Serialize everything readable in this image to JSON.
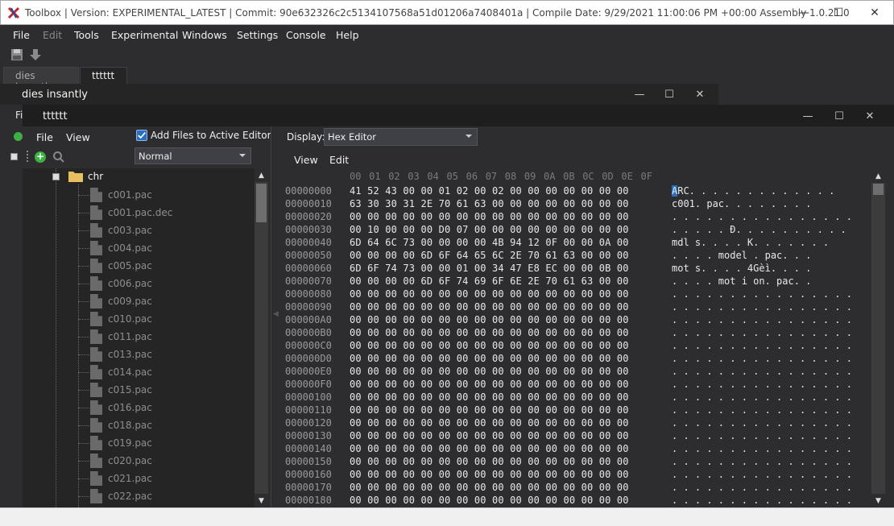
{
  "titlebar": {
    "title": "Toolbox | Version: EXPERIMENTAL_LATEST | Commit: 90e632326c2c5134107568a51d01206a7408401a | Compile Date: 9/29/2021 11:00:06 PM +00:00 Assembly 1.0.21.0",
    "minimize": "—",
    "maximize": "☐",
    "close": "✕"
  },
  "menubar": {
    "items": [
      "File",
      "Edit",
      "Tools",
      "Experimental",
      "Windows",
      "Settings",
      "Console",
      "Help"
    ]
  },
  "doc_tabs": [
    "dies insantly",
    "tttttt"
  ],
  "outer_window": {
    "title": "dies insantly",
    "side_label": "Fi"
  },
  "inner_window": {
    "title": "tttttt"
  },
  "left_panel": {
    "menu": [
      "File",
      "View"
    ],
    "add_files_label": "Add Files to Active Editor",
    "mode_value": "Normal",
    "tree": {
      "folder": "chr",
      "files": [
        "c001.pac",
        "c001.pac.dec",
        "c003.pac",
        "c004.pac",
        "c005.pac",
        "c006.pac",
        "c009.pac",
        "c010.pac",
        "c011.pac",
        "c013.pac",
        "c014.pac",
        "c015.pac",
        "c016.pac",
        "c018.pac",
        "c019.pac",
        "c020.pac",
        "c021.pac",
        "c022.pac"
      ]
    }
  },
  "right_panel": {
    "display_label": "Display:",
    "display_value": "Hex Editor",
    "menu": [
      "View",
      "Edit"
    ],
    "hex_header": [
      "00",
      "01",
      "02",
      "03",
      "04",
      "05",
      "06",
      "07",
      "08",
      "09",
      "0A",
      "0B",
      "0C",
      "0D",
      "0E",
      "0F"
    ],
    "rows": [
      {
        "addr": "00000000",
        "bytes": "41 52 43 00 00 01 02 00 02 00 00 00 00 00 00 00",
        "ascii_sel": "A",
        "ascii": "RC. . . . . . . . . . . . ."
      },
      {
        "addr": "00000010",
        "bytes": "63 30 30 31 2E 70 61 63 00 00 00 00 00 00 00 00",
        "ascii_sel": "",
        "ascii": "c001. pac. . . . . . . ."
      },
      {
        "addr": "00000020",
        "bytes": "00 00 00 00 00 00 00 00 00 00 00 00 00 00 00 00",
        "ascii_sel": "",
        "ascii": ". . . . . . . . . . . . . . . ."
      },
      {
        "addr": "00000030",
        "bytes": "00 10 00 00 00 D0 07 00 00 00 00 00 00 00 00 00",
        "ascii_sel": "",
        "ascii": ". . . . . Đ. . . . . . . . . ."
      },
      {
        "addr": "00000040",
        "bytes": "6D 64 6C 73 00 00 00 00 4B 94 12 0F 00 00 0A 00",
        "ascii_sel": "",
        "ascii": "mdl s. . . . K. . . . . . ."
      },
      {
        "addr": "00000050",
        "bytes": "00 00 00 00 6D 6F 64 65 6C 2E 70 61 63 00 00 00",
        "ascii_sel": "",
        "ascii": ". . . . model . pac. . ."
      },
      {
        "addr": "00000060",
        "bytes": "6D 6F 74 73 00 00 01 00 34 47 E8 EC 00 00 0B 00",
        "ascii_sel": "",
        "ascii": "mot s. . . . 4Gèì. . . ."
      },
      {
        "addr": "00000070",
        "bytes": "00 00 00 00 6D 6F 74 69 6F 6E 2E 70 61 63 00 00",
        "ascii_sel": "",
        "ascii": ". . . . mot i on. pac. ."
      },
      {
        "addr": "00000080",
        "bytes": "00 00 00 00 00 00 00 00 00 00 00 00 00 00 00 00",
        "ascii_sel": "",
        "ascii": ". . . . . . . . . . . . . . . ."
      },
      {
        "addr": "00000090",
        "bytes": "00 00 00 00 00 00 00 00 00 00 00 00 00 00 00 00",
        "ascii_sel": "",
        "ascii": ". . . . . . . . . . . . . . . ."
      },
      {
        "addr": "000000A0",
        "bytes": "00 00 00 00 00 00 00 00 00 00 00 00 00 00 00 00",
        "ascii_sel": "",
        "ascii": ". . . . . . . . . . . . . . . ."
      },
      {
        "addr": "000000B0",
        "bytes": "00 00 00 00 00 00 00 00 00 00 00 00 00 00 00 00",
        "ascii_sel": "",
        "ascii": ". . . . . . . . . . . . . . . ."
      },
      {
        "addr": "000000C0",
        "bytes": "00 00 00 00 00 00 00 00 00 00 00 00 00 00 00 00",
        "ascii_sel": "",
        "ascii": ". . . . . . . . . . . . . . . ."
      },
      {
        "addr": "000000D0",
        "bytes": "00 00 00 00 00 00 00 00 00 00 00 00 00 00 00 00",
        "ascii_sel": "",
        "ascii": ". . . . . . . . . . . . . . . ."
      },
      {
        "addr": "000000E0",
        "bytes": "00 00 00 00 00 00 00 00 00 00 00 00 00 00 00 00",
        "ascii_sel": "",
        "ascii": ". . . . . . . . . . . . . . . ."
      },
      {
        "addr": "000000F0",
        "bytes": "00 00 00 00 00 00 00 00 00 00 00 00 00 00 00 00",
        "ascii_sel": "",
        "ascii": ". . . . . . . . . . . . . . . ."
      },
      {
        "addr": "00000100",
        "bytes": "00 00 00 00 00 00 00 00 00 00 00 00 00 00 00 00",
        "ascii_sel": "",
        "ascii": ". . . . . . . . . . . . . . . ."
      },
      {
        "addr": "00000110",
        "bytes": "00 00 00 00 00 00 00 00 00 00 00 00 00 00 00 00",
        "ascii_sel": "",
        "ascii": ". . . . . . . . . . . . . . . ."
      },
      {
        "addr": "00000120",
        "bytes": "00 00 00 00 00 00 00 00 00 00 00 00 00 00 00 00",
        "ascii_sel": "",
        "ascii": ". . . . . . . . . . . . . . . ."
      },
      {
        "addr": "00000130",
        "bytes": "00 00 00 00 00 00 00 00 00 00 00 00 00 00 00 00",
        "ascii_sel": "",
        "ascii": ". . . . . . . . . . . . . . . ."
      },
      {
        "addr": "00000140",
        "bytes": "00 00 00 00 00 00 00 00 00 00 00 00 00 00 00 00",
        "ascii_sel": "",
        "ascii": ". . . . . . . . . . . . . . . ."
      },
      {
        "addr": "00000150",
        "bytes": "00 00 00 00 00 00 00 00 00 00 00 00 00 00 00 00",
        "ascii_sel": "",
        "ascii": ". . . . . . . . . . . . . . . ."
      },
      {
        "addr": "00000160",
        "bytes": "00 00 00 00 00 00 00 00 00 00 00 00 00 00 00 00",
        "ascii_sel": "",
        "ascii": ". . . . . . . . . . . . . . . ."
      },
      {
        "addr": "00000170",
        "bytes": "00 00 00 00 00 00 00 00 00 00 00 00 00 00 00 00",
        "ascii_sel": "",
        "ascii": ". . . . . . . . . . . . . . . ."
      },
      {
        "addr": "00000180",
        "bytes": "00 00 00 00 00 00 00 00 00 00 00 00 00 00 00 00",
        "ascii_sel": "",
        "ascii": ". . . . . . . . . . . . . . . ."
      }
    ]
  },
  "colors": {
    "background": "#2d2d30",
    "accent": "#2a6fbf",
    "folder": "#e8c060",
    "add_icon": "#3cb043"
  },
  "icons": [
    "app-logo-icon",
    "save-icon",
    "download-icon",
    "add-icon",
    "search-icon",
    "folder-icon",
    "file-icon",
    "collapse-icon"
  ]
}
